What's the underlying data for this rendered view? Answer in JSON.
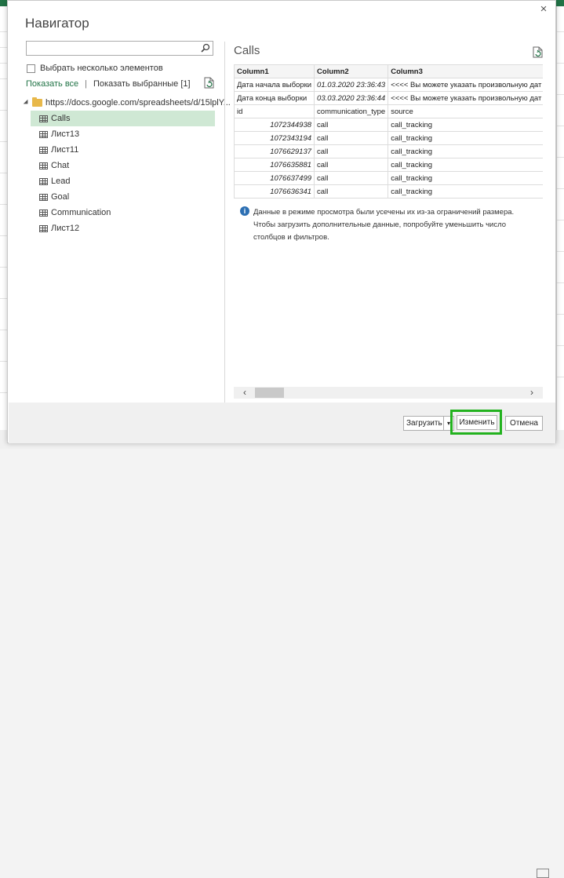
{
  "dialog": {
    "title": "Навигатор",
    "close_label": "×"
  },
  "left": {
    "search_placeholder": "",
    "multi_select_label": "Выбрать несколько элементов",
    "show_all": "Показать все",
    "separator": "|",
    "show_selected": "Показать выбранные [1]",
    "root_label": "https://docs.google.com/spreadsheets/d/15lplY...",
    "items": [
      {
        "label": "Calls",
        "selected": true
      },
      {
        "label": "Лист13"
      },
      {
        "label": "Лист11"
      },
      {
        "label": "Chat"
      },
      {
        "label": "Lead"
      },
      {
        "label": "Goal"
      },
      {
        "label": "Communication"
      },
      {
        "label": "Лист12"
      }
    ]
  },
  "preview": {
    "title": "Calls",
    "columns": [
      "Column1",
      "Column2",
      "Column3"
    ],
    "rows": [
      [
        "Дата начала выборки",
        "01.03.2020 23:36:43",
        "<<<< Вы можете указать произвольную дат"
      ],
      [
        "Дата конца выборки",
        "03.03.2020 23:36:44",
        "<<<< Вы можете указать произвольную дат"
      ],
      [
        "id",
        "communication_type",
        "source"
      ],
      [
        "1072344938",
        "call",
        "call_tracking"
      ],
      [
        "1072343194",
        "call",
        "call_tracking"
      ],
      [
        "1076629137",
        "call",
        "call_tracking"
      ],
      [
        "1076635881",
        "call",
        "call_tracking"
      ],
      [
        "1076637499",
        "call",
        "call_tracking"
      ],
      [
        "1076636341",
        "call",
        "call_tracking"
      ]
    ],
    "info_lines": [
      "Данные в режиме просмотра были усечены их из-за ограничений размера.",
      "Чтобы загрузить дополнительные данные, попробуйте уменьшить число",
      "столбцов и фильтров."
    ],
    "info_icon": "i"
  },
  "footer": {
    "load_label": "Загрузить",
    "load_arrow": "▾",
    "edit_label": "Изменить",
    "cancel_label": "Отмена"
  },
  "scroll": {
    "left_arrow": "‹",
    "right_arrow": "›"
  },
  "colors": {
    "accent": "#217346",
    "selected_bg": "#cfe8d4",
    "highlight": "#23b21f"
  }
}
